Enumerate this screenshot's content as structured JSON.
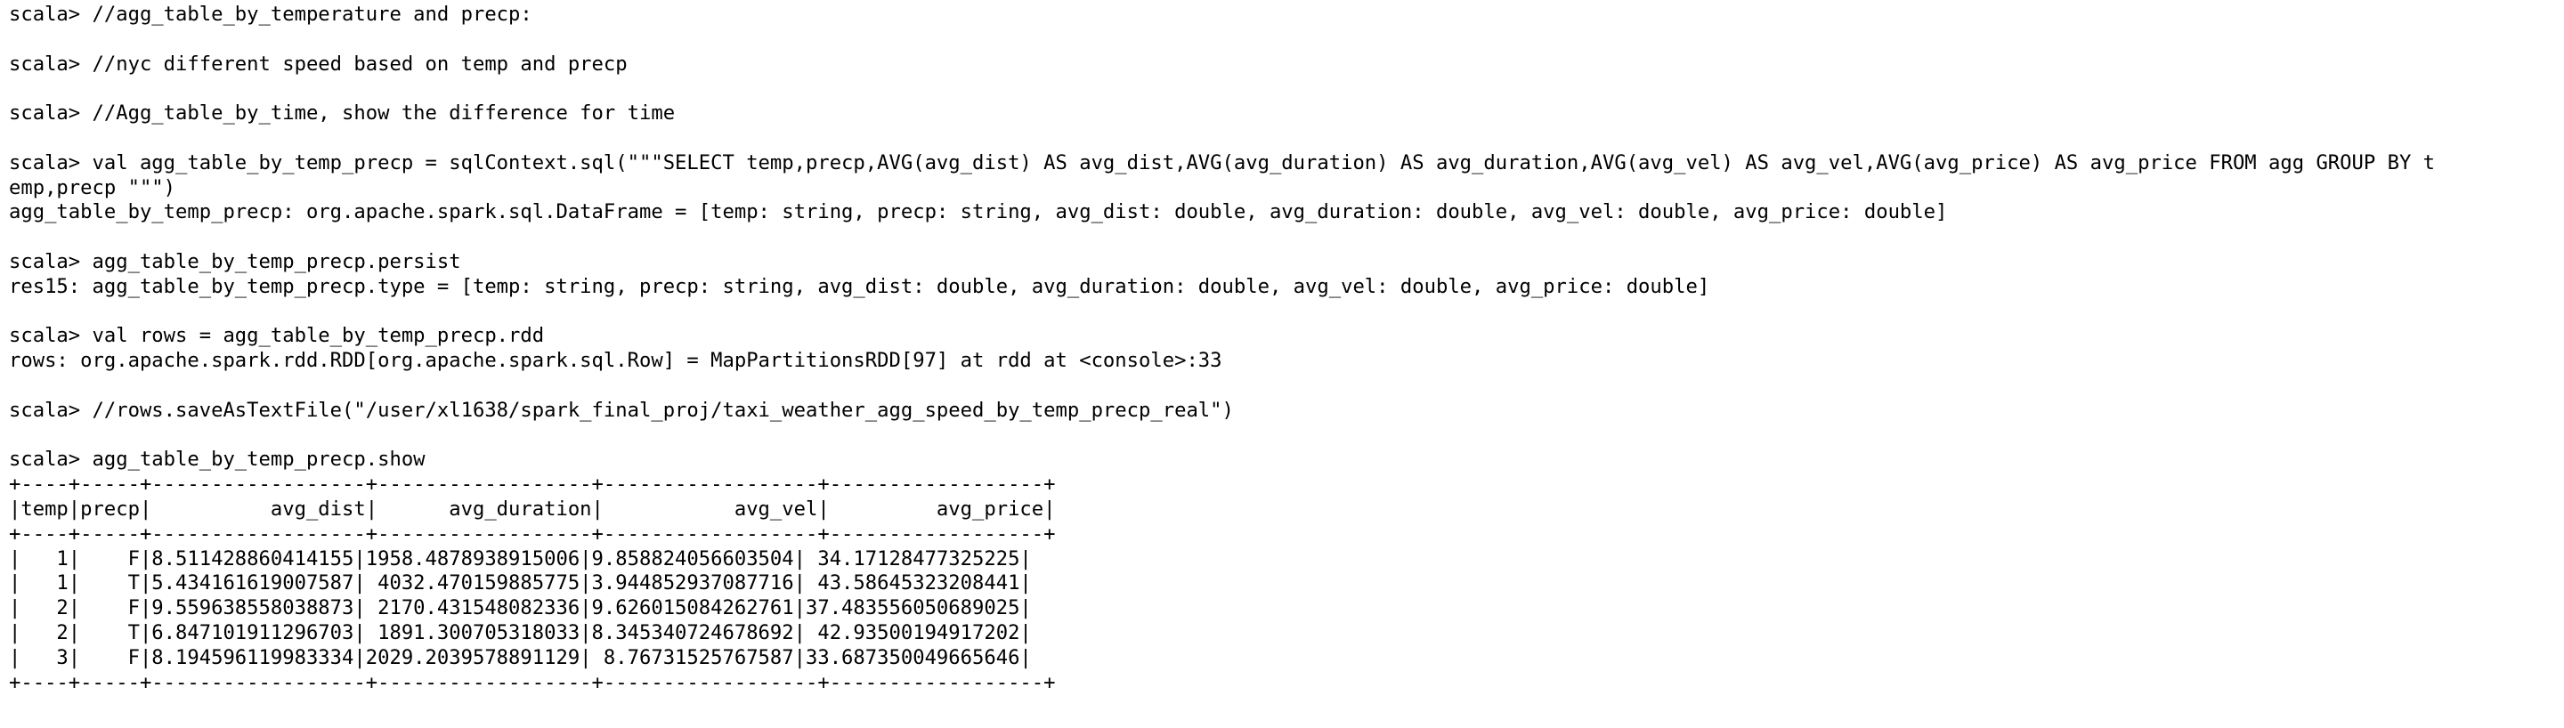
{
  "terminal": {
    "lines": [
      "scala> //agg_table_by_temperature and precp:",
      "",
      "scala> //nyc different speed based on temp and precp",
      "",
      "scala> //Agg_table_by_time, show the difference for time",
      "",
      "scala> val agg_table_by_temp_precp = sqlContext.sql(\"\"\"SELECT temp,precp,AVG(avg_dist) AS avg_dist,AVG(avg_duration) AS avg_duration,AVG(avg_vel) AS avg_vel,AVG(avg_price) AS avg_price FROM agg GROUP BY t",
      "emp,precp \"\"\")",
      "agg_table_by_temp_precp: org.apache.spark.sql.DataFrame = [temp: string, precp: string, avg_dist: double, avg_duration: double, avg_vel: double, avg_price: double]",
      "",
      "scala> agg_table_by_temp_precp.persist",
      "res15: agg_table_by_temp_precp.type = [temp: string, precp: string, avg_dist: double, avg_duration: double, avg_vel: double, avg_price: double]",
      "",
      "scala> val rows = agg_table_by_temp_precp.rdd",
      "rows: org.apache.spark.rdd.RDD[org.apache.spark.sql.Row] = MapPartitionsRDD[97] at rdd at <console>:33",
      "",
      "scala> //rows.saveAsTextFile(\"/user/xl1638/spark_final_proj/taxi_weather_agg_speed_by_temp_precp_real\")",
      "",
      "scala> agg_table_by_temp_precp.show",
      "+----+-----+------------------+------------------+------------------+------------------+",
      "|temp|precp|          avg_dist|      avg_duration|           avg_vel|         avg_price|",
      "+----+-----+------------------+------------------+------------------+------------------+",
      "|   1|    F|8.511428860414155|1958.4878938915006|9.858824056603504| 34.17128477325225|",
      "|   1|    T|5.434161619007587| 4032.470159885775|3.944852937087716| 43.58645323208441|",
      "|   2|    F|9.559638558038873| 2170.431548082336|9.626015084262761|37.483556050689025|",
      "|   2|    T|6.847101911296703| 1891.300705318033|8.345340724678692| 42.93500194917202|",
      "|   3|    F|8.194596119983334|2029.2039578891129| 8.76731525767587|33.687350049665646|",
      "+----+-----+------------------+------------------+------------------+------------------+"
    ]
  }
}
